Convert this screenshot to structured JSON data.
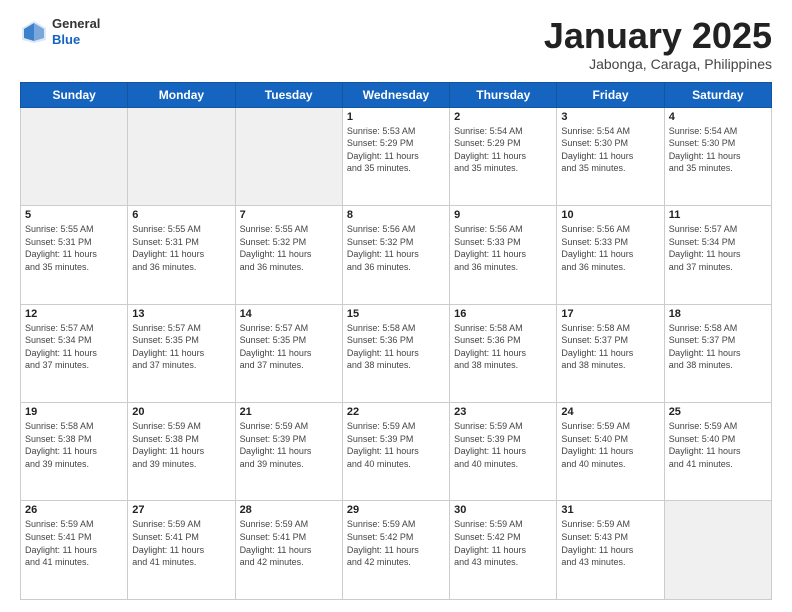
{
  "header": {
    "logo_general": "General",
    "logo_blue": "Blue",
    "month_title": "January 2025",
    "location": "Jabonga, Caraga, Philippines"
  },
  "weekdays": [
    "Sunday",
    "Monday",
    "Tuesday",
    "Wednesday",
    "Thursday",
    "Friday",
    "Saturday"
  ],
  "weeks": [
    [
      {
        "day": "",
        "info": "",
        "empty": true
      },
      {
        "day": "",
        "info": "",
        "empty": true
      },
      {
        "day": "",
        "info": "",
        "empty": true
      },
      {
        "day": "1",
        "info": "Sunrise: 5:53 AM\nSunset: 5:29 PM\nDaylight: 11 hours\nand 35 minutes.",
        "empty": false
      },
      {
        "day": "2",
        "info": "Sunrise: 5:54 AM\nSunset: 5:29 PM\nDaylight: 11 hours\nand 35 minutes.",
        "empty": false
      },
      {
        "day": "3",
        "info": "Sunrise: 5:54 AM\nSunset: 5:30 PM\nDaylight: 11 hours\nand 35 minutes.",
        "empty": false
      },
      {
        "day": "4",
        "info": "Sunrise: 5:54 AM\nSunset: 5:30 PM\nDaylight: 11 hours\nand 35 minutes.",
        "empty": false
      }
    ],
    [
      {
        "day": "5",
        "info": "Sunrise: 5:55 AM\nSunset: 5:31 PM\nDaylight: 11 hours\nand 35 minutes.",
        "empty": false
      },
      {
        "day": "6",
        "info": "Sunrise: 5:55 AM\nSunset: 5:31 PM\nDaylight: 11 hours\nand 36 minutes.",
        "empty": false
      },
      {
        "day": "7",
        "info": "Sunrise: 5:55 AM\nSunset: 5:32 PM\nDaylight: 11 hours\nand 36 minutes.",
        "empty": false
      },
      {
        "day": "8",
        "info": "Sunrise: 5:56 AM\nSunset: 5:32 PM\nDaylight: 11 hours\nand 36 minutes.",
        "empty": false
      },
      {
        "day": "9",
        "info": "Sunrise: 5:56 AM\nSunset: 5:33 PM\nDaylight: 11 hours\nand 36 minutes.",
        "empty": false
      },
      {
        "day": "10",
        "info": "Sunrise: 5:56 AM\nSunset: 5:33 PM\nDaylight: 11 hours\nand 36 minutes.",
        "empty": false
      },
      {
        "day": "11",
        "info": "Sunrise: 5:57 AM\nSunset: 5:34 PM\nDaylight: 11 hours\nand 37 minutes.",
        "empty": false
      }
    ],
    [
      {
        "day": "12",
        "info": "Sunrise: 5:57 AM\nSunset: 5:34 PM\nDaylight: 11 hours\nand 37 minutes.",
        "empty": false
      },
      {
        "day": "13",
        "info": "Sunrise: 5:57 AM\nSunset: 5:35 PM\nDaylight: 11 hours\nand 37 minutes.",
        "empty": false
      },
      {
        "day": "14",
        "info": "Sunrise: 5:57 AM\nSunset: 5:35 PM\nDaylight: 11 hours\nand 37 minutes.",
        "empty": false
      },
      {
        "day": "15",
        "info": "Sunrise: 5:58 AM\nSunset: 5:36 PM\nDaylight: 11 hours\nand 38 minutes.",
        "empty": false
      },
      {
        "day": "16",
        "info": "Sunrise: 5:58 AM\nSunset: 5:36 PM\nDaylight: 11 hours\nand 38 minutes.",
        "empty": false
      },
      {
        "day": "17",
        "info": "Sunrise: 5:58 AM\nSunset: 5:37 PM\nDaylight: 11 hours\nand 38 minutes.",
        "empty": false
      },
      {
        "day": "18",
        "info": "Sunrise: 5:58 AM\nSunset: 5:37 PM\nDaylight: 11 hours\nand 38 minutes.",
        "empty": false
      }
    ],
    [
      {
        "day": "19",
        "info": "Sunrise: 5:58 AM\nSunset: 5:38 PM\nDaylight: 11 hours\nand 39 minutes.",
        "empty": false
      },
      {
        "day": "20",
        "info": "Sunrise: 5:59 AM\nSunset: 5:38 PM\nDaylight: 11 hours\nand 39 minutes.",
        "empty": false
      },
      {
        "day": "21",
        "info": "Sunrise: 5:59 AM\nSunset: 5:39 PM\nDaylight: 11 hours\nand 39 minutes.",
        "empty": false
      },
      {
        "day": "22",
        "info": "Sunrise: 5:59 AM\nSunset: 5:39 PM\nDaylight: 11 hours\nand 40 minutes.",
        "empty": false
      },
      {
        "day": "23",
        "info": "Sunrise: 5:59 AM\nSunset: 5:39 PM\nDaylight: 11 hours\nand 40 minutes.",
        "empty": false
      },
      {
        "day": "24",
        "info": "Sunrise: 5:59 AM\nSunset: 5:40 PM\nDaylight: 11 hours\nand 40 minutes.",
        "empty": false
      },
      {
        "day": "25",
        "info": "Sunrise: 5:59 AM\nSunset: 5:40 PM\nDaylight: 11 hours\nand 41 minutes.",
        "empty": false
      }
    ],
    [
      {
        "day": "26",
        "info": "Sunrise: 5:59 AM\nSunset: 5:41 PM\nDaylight: 11 hours\nand 41 minutes.",
        "empty": false
      },
      {
        "day": "27",
        "info": "Sunrise: 5:59 AM\nSunset: 5:41 PM\nDaylight: 11 hours\nand 41 minutes.",
        "empty": false
      },
      {
        "day": "28",
        "info": "Sunrise: 5:59 AM\nSunset: 5:41 PM\nDaylight: 11 hours\nand 42 minutes.",
        "empty": false
      },
      {
        "day": "29",
        "info": "Sunrise: 5:59 AM\nSunset: 5:42 PM\nDaylight: 11 hours\nand 42 minutes.",
        "empty": false
      },
      {
        "day": "30",
        "info": "Sunrise: 5:59 AM\nSunset: 5:42 PM\nDaylight: 11 hours\nand 43 minutes.",
        "empty": false
      },
      {
        "day": "31",
        "info": "Sunrise: 5:59 AM\nSunset: 5:43 PM\nDaylight: 11 hours\nand 43 minutes.",
        "empty": false
      },
      {
        "day": "",
        "info": "",
        "empty": true
      }
    ]
  ]
}
